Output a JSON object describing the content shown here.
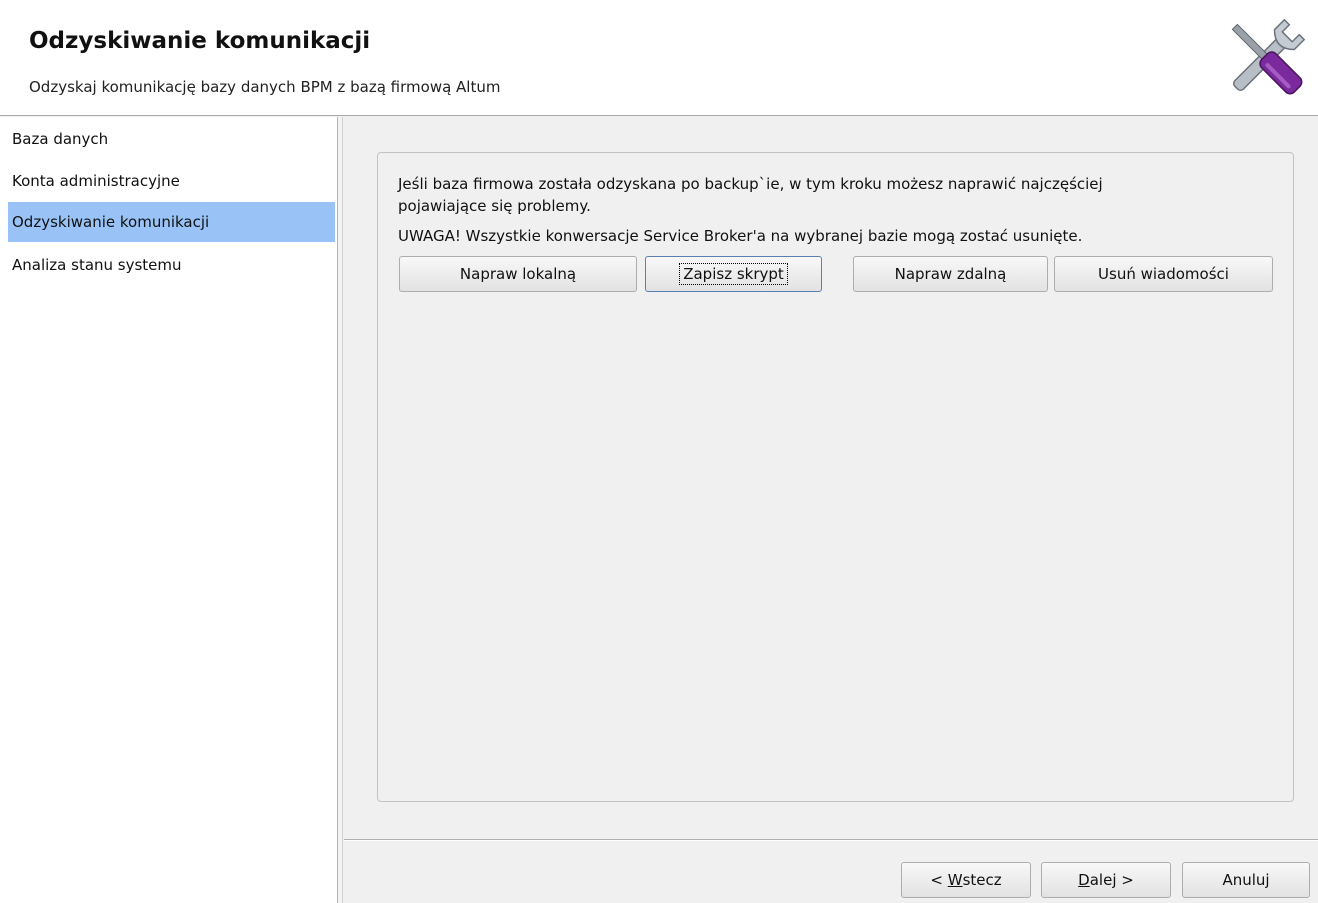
{
  "header": {
    "title": "Odzyskiwanie komunikacji",
    "subtitle": "Odzyskaj komunikację bazy danych BPM z bazą firmową Altum",
    "icon": "tools-icon"
  },
  "sidebar": {
    "items": [
      {
        "label": "Baza danych",
        "selected": false
      },
      {
        "label": "Konta administracyjne",
        "selected": false
      },
      {
        "label": "Odzyskiwanie komunikacji",
        "selected": true
      },
      {
        "label": "Analiza stanu systemu",
        "selected": false
      }
    ],
    "selected_color": "#99c3f7"
  },
  "panel": {
    "line1": "Jeśli baza firmowa została odzyskana po backup`ie, w tym kroku możesz naprawić najczęściej",
    "line2": "pojawiające się problemy.",
    "warning": "UWAGA! Wszystkie konwersacje Service Broker'a na wybranej bazie mogą zostać usunięte.",
    "buttons": {
      "repair_local": "Napraw lokalną",
      "save_script": "Zapisz skrypt",
      "repair_remote": "Napraw zdalną",
      "delete_messages": "Usuń wiadomości"
    }
  },
  "footer": {
    "back_prefix": "< ",
    "back_mnemonic": "W",
    "back_rest": "stecz",
    "next_mnemonic": "D",
    "next_rest": "alej >",
    "cancel": "Anuluj"
  }
}
